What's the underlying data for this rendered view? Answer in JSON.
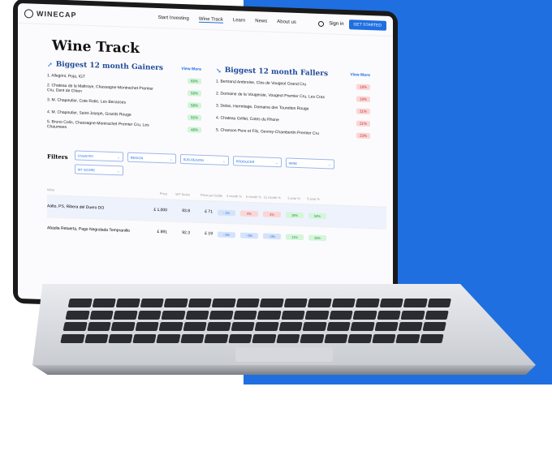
{
  "nav": {
    "logo": "WINECAP",
    "links": [
      "Start Investing",
      "Wine Track",
      "Learn",
      "News",
      "About us"
    ],
    "sign_in": "Sign in",
    "cta": "GET STARTED"
  },
  "page_title": "Wine Track",
  "gainers": {
    "title": "Biggest 12 month Gainers",
    "view_more": "View More",
    "items": [
      {
        "name": "1.  Allegrini, Poja, IGT",
        "change": "69%"
      },
      {
        "name": "2.  Chateau de la Maltroye, Chassagne-Montrachet Premier Cru, Dent de Chien",
        "change": "59%"
      },
      {
        "name": "3.  M. Chapoutier, Cote Rotie, Les Becasses",
        "change": "58%"
      },
      {
        "name": "4.  M. Chapoutier, Saint-Joseph, Granits Rouge",
        "change": "55%"
      },
      {
        "name": "5.  Bruno Colin, Chassagne-Montrachet Premier Cru, Les Chaumees",
        "change": "48%"
      }
    ]
  },
  "fallers": {
    "title": "Biggest 12 month Fallers",
    "view_more": "View More",
    "items": [
      {
        "name": "1.  Bertrand Ambroise, Clos de Vougeot Grand Cru",
        "change": "19%"
      },
      {
        "name": "2.  Domaine de la Vougeraie, Vougeot Premier Cru, Les Cras",
        "change": "19%"
      },
      {
        "name": "3.  Delas, Hermitage, Domaine des Tourettes Rouge",
        "change": "21%"
      },
      {
        "name": "4.  Chateau Grillet, Cotes du Rhone",
        "change": "21%"
      },
      {
        "name": "5.  Chanson Pere et Fils, Gevrey-Chambertin Premier Cru",
        "change": "23%"
      }
    ]
  },
  "filters": {
    "label": "Filters",
    "selects": [
      "COUNTRY",
      "REGION",
      "SUB-REGION",
      "PRODUCER",
      "WINE",
      "WT SCORE"
    ]
  },
  "table": {
    "headers": [
      "Wine",
      "Price",
      "WT Score",
      "Price per bottle",
      "3 month %",
      "6 month %",
      "12 month %",
      "3 year %",
      "5 year %"
    ],
    "rows": [
      {
        "wine": "Aalto, PS, Ribera del Duero DO",
        "price": "£ 1,000",
        "score": "93.8",
        "trade": "£ 71",
        "c3m": "- 1%",
        "c6m": "4%",
        "c12m": "3%",
        "c3y": "18%",
        "c5y": "54%"
      },
      {
        "wine": "Abadia Retuerta, Pago Negralada Tempranillo",
        "price": "£ 891",
        "score": "92.3",
        "trade": "£ 19",
        "c3m": "- 0%",
        "c6m": "- 0%",
        "c12m": "- 0%",
        "c3y": "11%",
        "c5y": "15%"
      }
    ]
  }
}
